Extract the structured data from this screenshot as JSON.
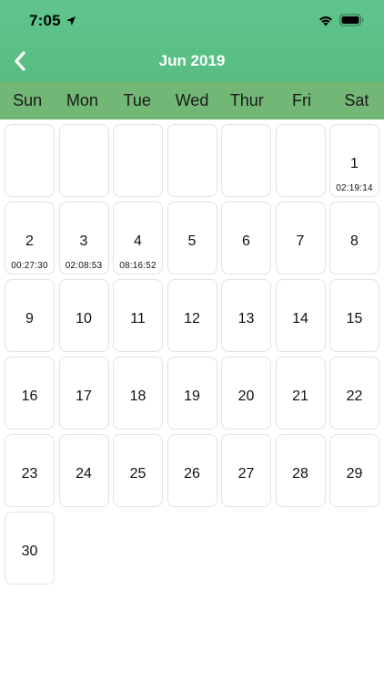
{
  "status_bar": {
    "time": "7:05"
  },
  "header": {
    "title": "Jun 2019",
    "back_icon": "chevron-left-icon"
  },
  "weekdays": [
    "Sun",
    "Mon",
    "Tue",
    "Wed",
    "Thur",
    "Fri",
    "Sat"
  ],
  "calendar": {
    "leading_blank_days": 6,
    "days": [
      {
        "day": "1",
        "time": "02:19:14"
      },
      {
        "day": "2",
        "time": "00:27:30"
      },
      {
        "day": "3",
        "time": "02:08:53"
      },
      {
        "day": "4",
        "time": "08:16:52"
      },
      {
        "day": "5"
      },
      {
        "day": "6"
      },
      {
        "day": "7"
      },
      {
        "day": "8"
      },
      {
        "day": "9"
      },
      {
        "day": "10"
      },
      {
        "day": "11"
      },
      {
        "day": "12"
      },
      {
        "day": "13"
      },
      {
        "day": "14"
      },
      {
        "day": "15"
      },
      {
        "day": "16"
      },
      {
        "day": "17"
      },
      {
        "day": "18"
      },
      {
        "day": "19"
      },
      {
        "day": "20"
      },
      {
        "day": "21"
      },
      {
        "day": "22"
      },
      {
        "day": "23"
      },
      {
        "day": "24"
      },
      {
        "day": "25"
      },
      {
        "day": "26"
      },
      {
        "day": "27"
      },
      {
        "day": "28"
      },
      {
        "day": "29"
      },
      {
        "day": "30"
      }
    ]
  },
  "colors": {
    "header_green": "#5fc58d",
    "weekday_bar": "#72b775",
    "cell_border": "#e2e2e2"
  }
}
